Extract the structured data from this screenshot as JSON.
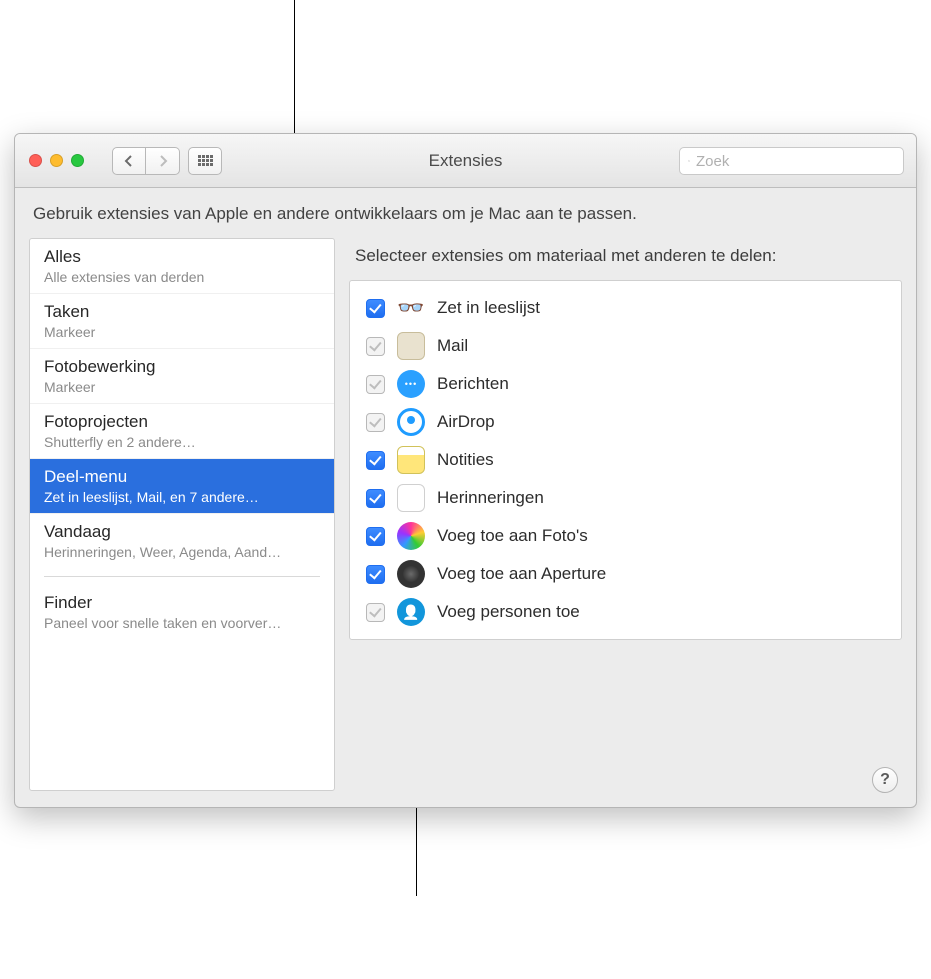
{
  "window": {
    "title": "Extensies",
    "search_placeholder": "Zoek",
    "description": "Gebruik extensies van Apple en andere ontwikkelaars om je Mac aan te passen."
  },
  "sidebar": {
    "items": [
      {
        "title": "Alles",
        "subtitle": "Alle extensies van derden"
      },
      {
        "title": "Taken",
        "subtitle": "Markeer"
      },
      {
        "title": "Fotobewerking",
        "subtitle": "Markeer"
      },
      {
        "title": "Fotoprojecten",
        "subtitle": "Shutterfly en 2 andere…"
      },
      {
        "title": "Deel-menu",
        "subtitle": "Zet in leeslijst, Mail, en 7 andere…"
      },
      {
        "title": "Vandaag",
        "subtitle": "Herinneringen, Weer, Agenda, Aand…"
      },
      {
        "title": "Finder",
        "subtitle": "Paneel voor snelle taken en voorver…"
      }
    ],
    "selected_index": 4
  },
  "main": {
    "heading": "Selecteer extensies om materiaal met anderen te delen:",
    "extensions": [
      {
        "label": "Zet in leeslijst",
        "checked": true,
        "locked": false,
        "icon": "glasses"
      },
      {
        "label": "Mail",
        "checked": true,
        "locked": true,
        "icon": "mail"
      },
      {
        "label": "Berichten",
        "checked": true,
        "locked": true,
        "icon": "messages"
      },
      {
        "label": "AirDrop",
        "checked": true,
        "locked": true,
        "icon": "airdrop"
      },
      {
        "label": "Notities",
        "checked": true,
        "locked": false,
        "icon": "notes"
      },
      {
        "label": "Herinneringen",
        "checked": true,
        "locked": false,
        "icon": "reminders"
      },
      {
        "label": "Voeg toe aan Foto's",
        "checked": true,
        "locked": false,
        "icon": "photos"
      },
      {
        "label": "Voeg toe aan Aperture",
        "checked": true,
        "locked": false,
        "icon": "aperture"
      },
      {
        "label": "Voeg personen toe",
        "checked": true,
        "locked": true,
        "icon": "people"
      }
    ]
  },
  "help_glyph": "?"
}
